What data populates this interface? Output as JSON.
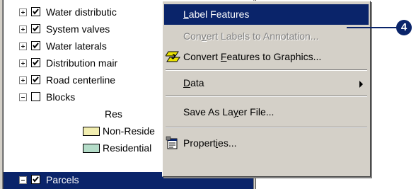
{
  "toc": {
    "layers": [
      {
        "name": "Water distributic",
        "expander": "plus",
        "checked": true
      },
      {
        "name": "System valves",
        "expander": "plus",
        "checked": true
      },
      {
        "name": "Water laterals",
        "expander": "plus",
        "checked": true
      },
      {
        "name": "Distribution mair",
        "expander": "plus",
        "checked": true
      },
      {
        "name": "Road centerline",
        "expander": "plus",
        "checked": true
      },
      {
        "name": "Blocks",
        "expander": "minus",
        "checked": false
      }
    ],
    "legend": {
      "field": "Res",
      "classes": [
        {
          "label": "Non-Reside",
          "color": "#f2eeb0"
        },
        {
          "label": "Residential",
          "color": "#b4dcc8"
        }
      ]
    },
    "selected_layer": {
      "name": "Parcels",
      "expander": "minus",
      "checked": true
    }
  },
  "context_menu": {
    "items": [
      {
        "label": "Label Features",
        "accel": "L",
        "state": "highlighted"
      },
      {
        "label": "Convert Labels to Annotation...",
        "accel": "v",
        "state": "disabled"
      },
      {
        "label": "Convert Features to Graphics...",
        "accel": "F",
        "state": "normal",
        "icon": "convert-features-icon"
      },
      {
        "label": "Data",
        "accel": "D",
        "state": "submenu"
      },
      {
        "label": "Save As Layer File...",
        "accel": "y",
        "state": "normal"
      },
      {
        "label": "Properties...",
        "accel": "i",
        "state": "normal",
        "icon": "properties-icon"
      }
    ]
  },
  "callout": {
    "number": "4",
    "color": "#0a246a"
  },
  "colors": {
    "selection": "#0a246a",
    "menu_face": "#d4d0c8",
    "disabled_text": "#808080"
  }
}
